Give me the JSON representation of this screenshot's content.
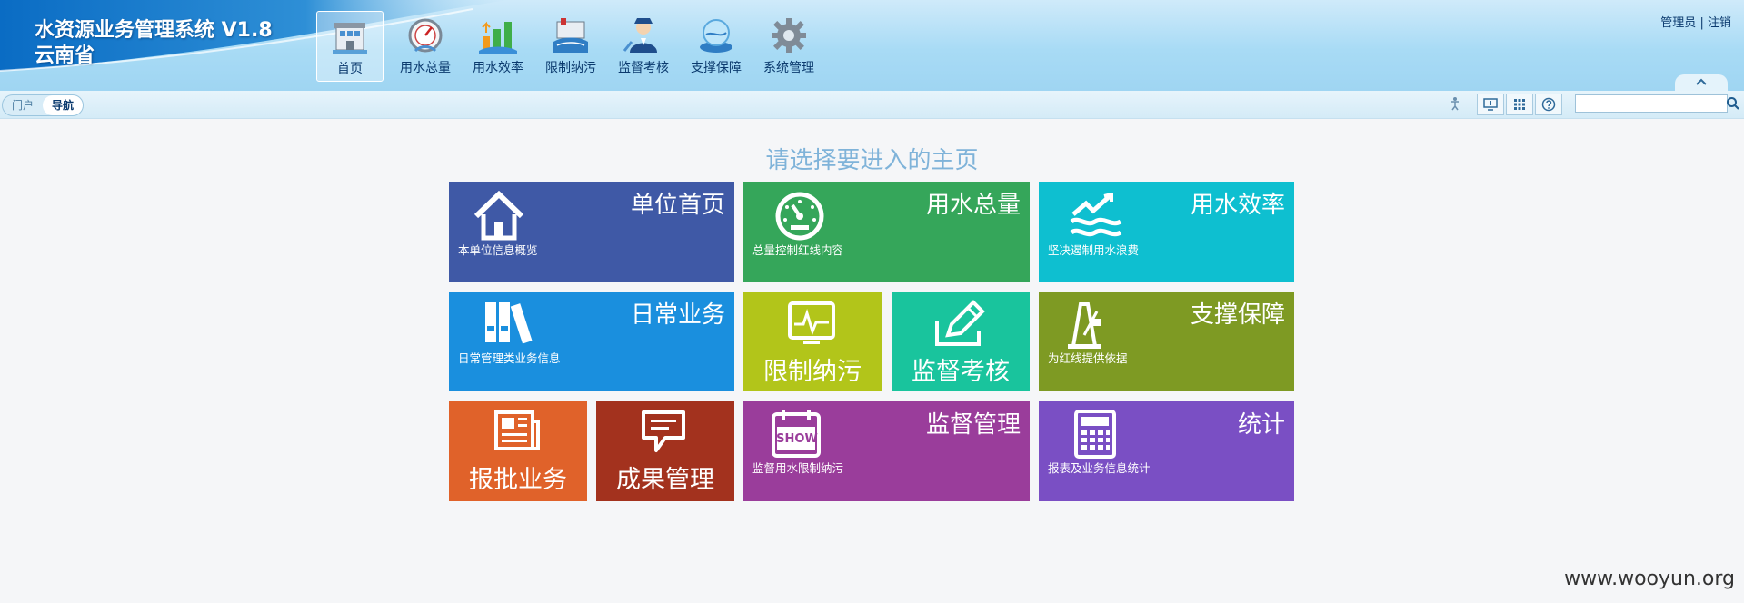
{
  "header": {
    "system_title": "水资源业务管理系统 V1.8",
    "province": "云南省",
    "user": "管理员",
    "separator": "|",
    "logout": "注销"
  },
  "nav": [
    {
      "label": "首页",
      "icon": "home-building-icon",
      "active": true
    },
    {
      "label": "用水总量",
      "icon": "water-meter-icon"
    },
    {
      "label": "用水效率",
      "icon": "efficiency-arrows-icon"
    },
    {
      "label": "限制纳污",
      "icon": "pollution-control-icon"
    },
    {
      "label": "监督考核",
      "icon": "inspector-icon"
    },
    {
      "label": "支撑保障",
      "icon": "water-globe-icon"
    },
    {
      "label": "系统管理",
      "icon": "gear-icon"
    }
  ],
  "toolbar": {
    "seg_portal": "门户",
    "seg_nav": "导航",
    "search_value": ""
  },
  "main": {
    "choose_title": "请选择要进入的主页"
  },
  "tiles": [
    {
      "title": "单位首页",
      "desc": "本单位信息概览",
      "color": "#3f59a6"
    },
    {
      "title": "用水总量",
      "desc": "总量控制红线内容",
      "color": "#35a65a"
    },
    {
      "title": "用水效率",
      "desc": "坚决遏制用水浪费",
      "color": "#0ebfd0"
    },
    {
      "title": "日常业务",
      "desc": "日常管理类业务信息",
      "color": "#1a8fde"
    },
    {
      "title": "限制纳污",
      "color": "#b2c51a"
    },
    {
      "title": "监督考核",
      "color": "#19c49d"
    },
    {
      "title": "支撑保障",
      "desc": "为红线提供依据",
      "color": "#7e9a23"
    },
    {
      "title": "报批业务",
      "color": "#e0622a"
    },
    {
      "title": "成果管理",
      "color": "#a3321e"
    },
    {
      "title": "监督管理",
      "desc": "监督用水限制纳污",
      "color": "#9a3d9b",
      "badge": "SHOW"
    },
    {
      "title": "统计",
      "desc": "报表及业务信息统计",
      "color": "#7a4fc4"
    }
  ],
  "footer": {
    "watermark": "www.wooyun.org"
  }
}
